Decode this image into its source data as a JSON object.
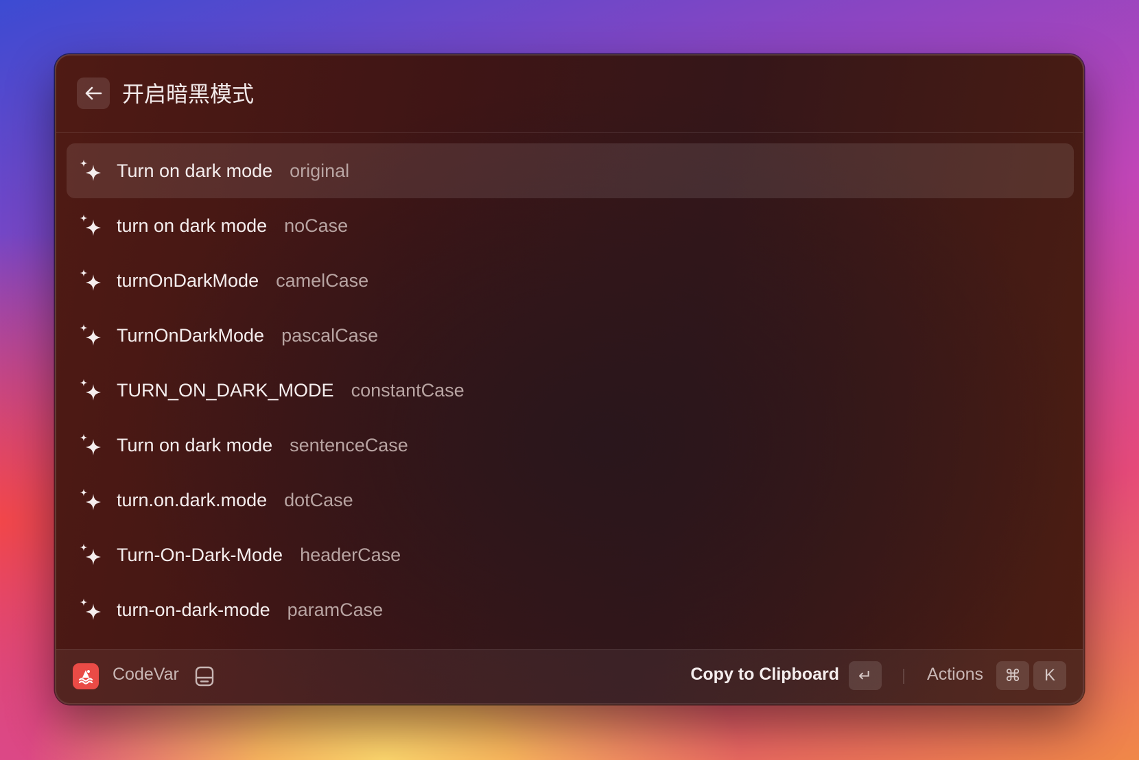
{
  "header": {
    "title": "开启暗黑模式",
    "back_icon": "arrow-left-icon"
  },
  "results": [
    {
      "value": "Turn on dark mode",
      "case": "original",
      "selected": true,
      "icon": "sparkles-icon"
    },
    {
      "value": "turn on dark mode",
      "case": "noCase",
      "selected": false,
      "icon": "sparkles-icon"
    },
    {
      "value": "turnOnDarkMode",
      "case": "camelCase",
      "selected": false,
      "icon": "sparkles-icon"
    },
    {
      "value": "TurnOnDarkMode",
      "case": "pascalCase",
      "selected": false,
      "icon": "sparkles-icon"
    },
    {
      "value": "TURN_ON_DARK_MODE",
      "case": "constantCase",
      "selected": false,
      "icon": "sparkles-icon"
    },
    {
      "value": "Turn on dark mode",
      "case": "sentenceCase",
      "selected": false,
      "icon": "sparkles-icon"
    },
    {
      "value": "turn.on.dark.mode",
      "case": "dotCase",
      "selected": false,
      "icon": "sparkles-icon"
    },
    {
      "value": "Turn-On-Dark-Mode",
      "case": "headerCase",
      "selected": false,
      "icon": "sparkles-icon"
    },
    {
      "value": "turn-on-dark-mode",
      "case": "paramCase",
      "selected": false,
      "icon": "sparkles-icon"
    }
  ],
  "footer": {
    "app_name": "CodeVar",
    "primary_action": "Copy to Clipboard",
    "primary_shortcut": "↵",
    "actions_label": "Actions",
    "actions_shortcut_mod": "⌘",
    "actions_shortcut_key": "K"
  },
  "colors": {
    "app_icon_bg": "#ea4b46",
    "selected_row_bg": "rgba(255,255,255,0.10)"
  }
}
